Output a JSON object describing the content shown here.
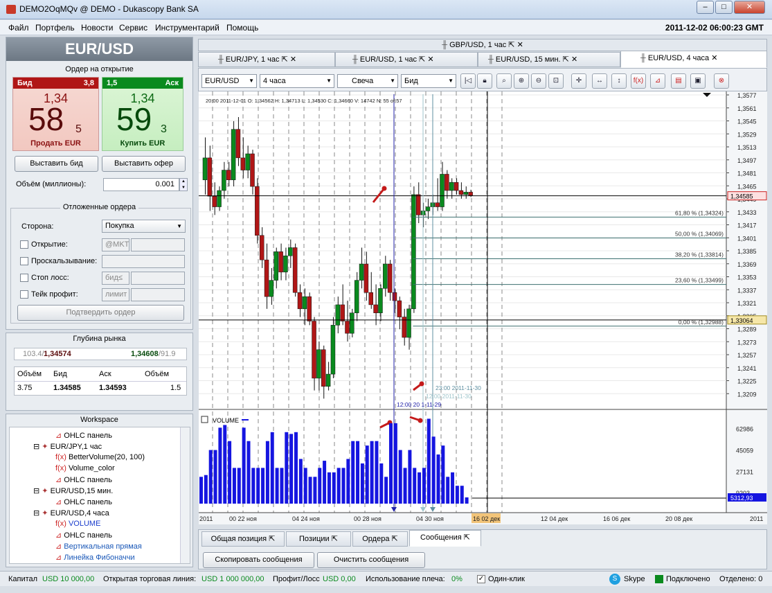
{
  "window": {
    "title": "DEMO2OqMQv @ DEMO - Dukascopy Bank SA",
    "min": "–",
    "max": "□",
    "close": "✕"
  },
  "menu": [
    "Файл",
    "Портфель",
    "Новости",
    "Сервис",
    "Инструментарий",
    "Помощь"
  ],
  "clock": "2011-12-02 06:00:23  GMT",
  "instrument": "EUR/USD",
  "order": {
    "title": "Ордер на открытие",
    "bid_label": "Бид",
    "bid_spread": "3,8",
    "bid_small": "1,34",
    "bid_big": "58",
    "bid_pip": "5",
    "sell_label": "Продать EUR",
    "ask_label": "Аск",
    "ask_spread": "1,5",
    "ask_small": "1,34",
    "ask_big": "59",
    "ask_pip": "3",
    "buy_label": "Купить EUR",
    "place_bid": "Выставить бид",
    "place_offer": "Выставить офер",
    "volume_label": "Объём (миллионы):",
    "volume_value": "0.001"
  },
  "pending": {
    "title": "Отложенные ордера",
    "side_label": "Сторона:",
    "side_value": "Покупка",
    "open_label": "Открытие:",
    "open_ph": "@MKT",
    "slip_label": "Проскальзывание:",
    "sl_label": "Стоп лосс:",
    "sl_ph": "бид≤",
    "tp_label": "Тейк профит:",
    "tp_ph": "лимит",
    "confirm": "Подтвердить ордер"
  },
  "depth": {
    "title": "Глубина рынка",
    "bid_vol": "103.4/",
    "bid_price": "1,34574",
    "ask_price": "1,34608",
    "ask_vol": "/91.9",
    "headers": [
      "Объём",
      "Бид",
      "Аск",
      "Объём"
    ],
    "row": [
      "3.75",
      "1.34585",
      "1.34593",
      "1.5"
    ]
  },
  "workspace": {
    "title": "Workspace",
    "items": [
      "OHLC панель",
      "EUR/JPY,1 час",
      "BetterVolume(20, 100)",
      "Volume_color",
      "OHLC панель",
      "EUR/USD,15 мин.",
      "OHLC панель",
      "EUR/USD,4 часа",
      "VOLUME",
      "OHLC панель",
      "Вертикальная прямая",
      "Линейка Фибоначчи"
    ]
  },
  "chart_tabs": {
    "top": "GBP/USD, 1 час",
    "tabs": [
      "EUR/JPY, 1 час",
      "EUR/USD, 1 час",
      "EUR/USD, 15 мин.",
      "EUR/USD, 4 часа"
    ]
  },
  "toolbar": {
    "instrument": "EUR/USD",
    "period": "4 часа",
    "type": "Свеча",
    "side": "Бид"
  },
  "chart_info": "20:00 2011-12-01   O: 1,34562   H: 1,34713   L: 1,34530   C: 1,34660   V: 14742   N: 55 of 57",
  "colors": {
    "up": "#0a8a1e",
    "down": "#b01616",
    "volume": "#1515e0",
    "fib": "#3b6f6f"
  },
  "chart_data": {
    "type": "candlestick",
    "y_ticks": [
      "1,3577",
      "1,3561",
      "1,3545",
      "1,3529",
      "1,3513",
      "1,3497",
      "1,3481",
      "1,3465",
      "1,3449",
      "1,3433",
      "1,3417",
      "1,3401",
      "1,3385",
      "1,3369",
      "1,3353",
      "1,3337",
      "1,3321",
      "1,3305",
      "1,3289",
      "1,3273",
      "1,3257",
      "1,3241",
      "1,3225",
      "1,3209"
    ],
    "ylim": [
      1.3201,
      1.3583
    ],
    "candles": [
      [
        1.3478,
        1.353,
        1.346,
        1.3505
      ],
      [
        1.3505,
        1.352,
        1.344,
        1.3458
      ],
      [
        1.3458,
        1.3475,
        1.3435,
        1.3445
      ],
      [
        1.3445,
        1.347,
        1.344,
        1.3465
      ],
      [
        1.3465,
        1.35,
        1.3455,
        1.349
      ],
      [
        1.349,
        1.35,
        1.347,
        1.3478
      ],
      [
        1.3478,
        1.355,
        1.347,
        1.354
      ],
      [
        1.354,
        1.3555,
        1.3495,
        1.3505
      ],
      [
        1.3505,
        1.353,
        1.348,
        1.349
      ],
      [
        1.349,
        1.352,
        1.348,
        1.351
      ],
      [
        1.351,
        1.3515,
        1.346,
        1.347
      ],
      [
        1.347,
        1.348,
        1.34,
        1.341
      ],
      [
        1.341,
        1.342,
        1.337,
        1.338
      ],
      [
        1.338,
        1.34,
        1.332,
        1.3335
      ],
      [
        1.3335,
        1.337,
        1.3325,
        1.3355
      ],
      [
        1.3355,
        1.3395,
        1.3345,
        1.339
      ],
      [
        1.339,
        1.34,
        1.3355,
        1.3365
      ],
      [
        1.3365,
        1.3395,
        1.3355,
        1.3385
      ],
      [
        1.3385,
        1.3405,
        1.337,
        1.3395
      ],
      [
        1.3395,
        1.34,
        1.3335,
        1.334
      ],
      [
        1.334,
        1.335,
        1.331,
        1.332
      ],
      [
        1.332,
        1.3345,
        1.33,
        1.3335
      ],
      [
        1.3335,
        1.334,
        1.33,
        1.3305
      ],
      [
        1.3305,
        1.331,
        1.322,
        1.3235
      ],
      [
        1.3235,
        1.328,
        1.322,
        1.327
      ],
      [
        1.327,
        1.3275,
        1.321,
        1.3225
      ],
      [
        1.3225,
        1.3255,
        1.322,
        1.324
      ],
      [
        1.324,
        1.331,
        1.3235,
        1.33
      ],
      [
        1.33,
        1.3335,
        1.329,
        1.3325
      ],
      [
        1.3325,
        1.335,
        1.33,
        1.3305
      ],
      [
        1.3305,
        1.333,
        1.328,
        1.329
      ],
      [
        1.329,
        1.332,
        1.3285,
        1.3315
      ],
      [
        1.3315,
        1.3365,
        1.3305,
        1.3355
      ],
      [
        1.3355,
        1.3395,
        1.3345,
        1.3375
      ],
      [
        1.3375,
        1.339,
        1.333,
        1.334
      ],
      [
        1.334,
        1.3365,
        1.332,
        1.3325
      ],
      [
        1.3325,
        1.335,
        1.33,
        1.3315
      ],
      [
        1.3315,
        1.335,
        1.3305,
        1.3345
      ],
      [
        1.3345,
        1.3385,
        1.3335,
        1.3375
      ],
      [
        1.3375,
        1.338,
        1.333,
        1.334
      ],
      [
        1.334,
        1.3345,
        1.3315,
        1.333
      ],
      [
        1.333,
        1.3335,
        1.3295,
        1.331
      ],
      [
        1.331,
        1.332,
        1.3275,
        1.3285
      ],
      [
        1.3285,
        1.3325,
        1.327,
        1.332
      ],
      [
        1.332,
        1.347,
        1.3315,
        1.346
      ],
      [
        1.346,
        1.3475,
        1.3425,
        1.3435
      ],
      [
        1.3435,
        1.345,
        1.342,
        1.344
      ],
      [
        1.344,
        1.3455,
        1.343,
        1.3445
      ],
      [
        1.3445,
        1.346,
        1.3435,
        1.345
      ],
      [
        1.345,
        1.348,
        1.344,
        1.3445
      ],
      [
        1.3445,
        1.35,
        1.344,
        1.3485
      ],
      [
        1.3485,
        1.349,
        1.3455,
        1.3465
      ],
      [
        1.3465,
        1.348,
        1.3455,
        1.3475
      ],
      [
        1.3475,
        1.348,
        1.346,
        1.3465
      ],
      [
        1.3465,
        1.3475,
        1.3455,
        1.346
      ],
      [
        1.346,
        1.347,
        1.3455,
        1.3463
      ],
      [
        1.3463,
        1.3466,
        1.3457,
        1.3459
      ]
    ],
    "price_label": "1,34585",
    "low_label": "1,33064",
    "fib": [
      {
        "label": "61,80 % (1,34324)",
        "v": 1.34324
      },
      {
        "label": "50,00 % (1,34069)",
        "v": 1.34069
      },
      {
        "label": "38,20 % (1,33814)",
        "v": 1.33814
      },
      {
        "label": "23,60 % (1,33499)",
        "v": 1.33499
      },
      {
        "label": "0,00 % (1,32988)",
        "v": 1.32988
      }
    ],
    "vlines": [
      {
        "label": "12:00 20 1-11-29"
      },
      {
        "label": "12:00 2011-11-30"
      },
      {
        "label": "23:00 2011-11-30"
      }
    ],
    "volume": {
      "title": "VOLUME",
      "ticks": [
        "62986",
        "45059",
        "27131",
        "9203"
      ],
      "current": "5312,93",
      "values": [
        30,
        32,
        60,
        60,
        85,
        88,
        70,
        40,
        40,
        85,
        70,
        40,
        40,
        40,
        70,
        80,
        40,
        40,
        80,
        78,
        80,
        50,
        40,
        30,
        30,
        40,
        48,
        35,
        35,
        40,
        40,
        50,
        70,
        70,
        45,
        65,
        70,
        70,
        45,
        30,
        90,
        90,
        60,
        40,
        60,
        40,
        35,
        40,
        95,
        75,
        55,
        65,
        30,
        35,
        20,
        20,
        7
      ]
    },
    "x_ticks": [
      "2011",
      "00 22 ноя",
      "04 24 ноя",
      "00 28 ноя",
      "04 30 ноя",
      "16 02 дек",
      "12 04 дек",
      "16 06 дек",
      "20 08 дек",
      "2011"
    ]
  },
  "bottom_tabs": [
    "Общая позиция",
    "Позиции",
    "Ордера",
    "Сообщения"
  ],
  "bottom_buttons": {
    "copy": "Скопировать сообщения",
    "clear": "Очистить сообщения"
  },
  "status": {
    "capital_label": "Капитал",
    "capital": "USD 10 000,00",
    "line_label": "Открытая торговая линия:",
    "line": "USD 1 000 000,00",
    "pl_label": "Профит/Лосс",
    "pl": "USD 0,00",
    "lev_label": "Использование плеча:",
    "lev": "0%",
    "oneclick": "Один-клик",
    "skype": "Skype",
    "connected": "Подключено",
    "sent": "Отделено: 0"
  }
}
